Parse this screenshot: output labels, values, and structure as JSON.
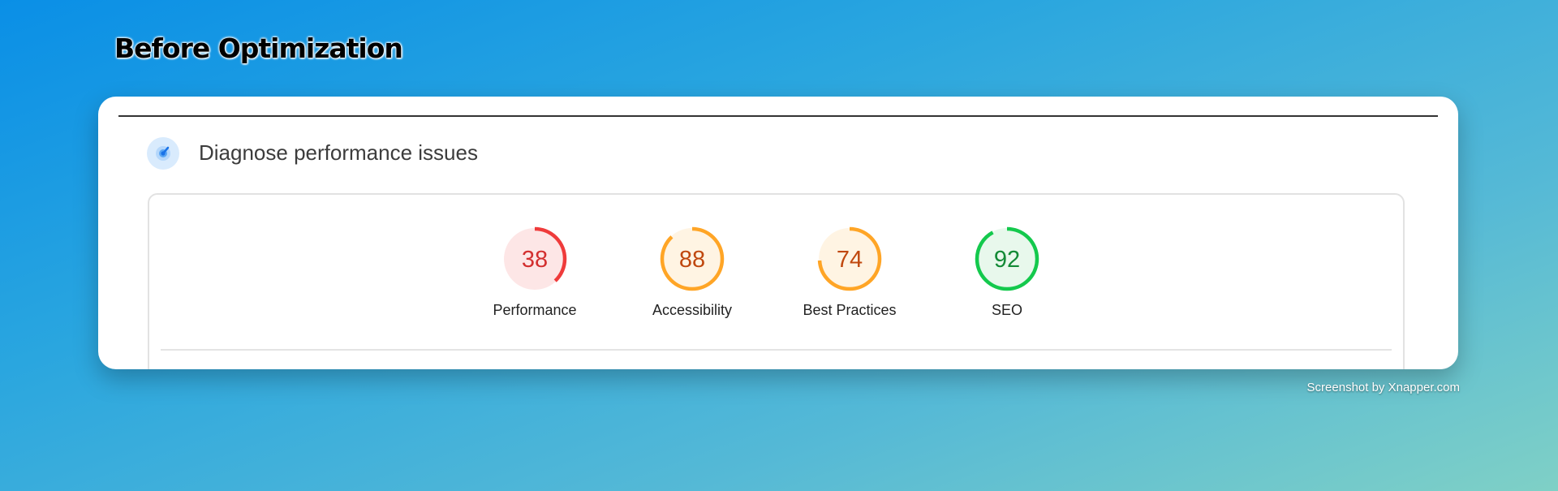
{
  "heading": "Before Optimization",
  "diagnose": {
    "title": "Diagnose performance issues",
    "icon": "lighthouse-gauge-icon"
  },
  "scores": [
    {
      "label": "Performance",
      "score": 38,
      "color": "#ef3b3b",
      "fill": "#fde6e6",
      "text_color": "#d32f2f"
    },
    {
      "label": "Accessibility",
      "score": 88,
      "color": "#ffa526",
      "fill": "#fff4e3",
      "text_color": "#c0480f"
    },
    {
      "label": "Best Practices",
      "score": 74,
      "color": "#ffa526",
      "fill": "#fff4e3",
      "text_color": "#c0480f"
    },
    {
      "label": "SEO",
      "score": 92,
      "color": "#14c94d",
      "fill": "#e8f8ec",
      "text_color": "#138a36"
    }
  ],
  "watermark": "Screenshot by Xnapper.com"
}
